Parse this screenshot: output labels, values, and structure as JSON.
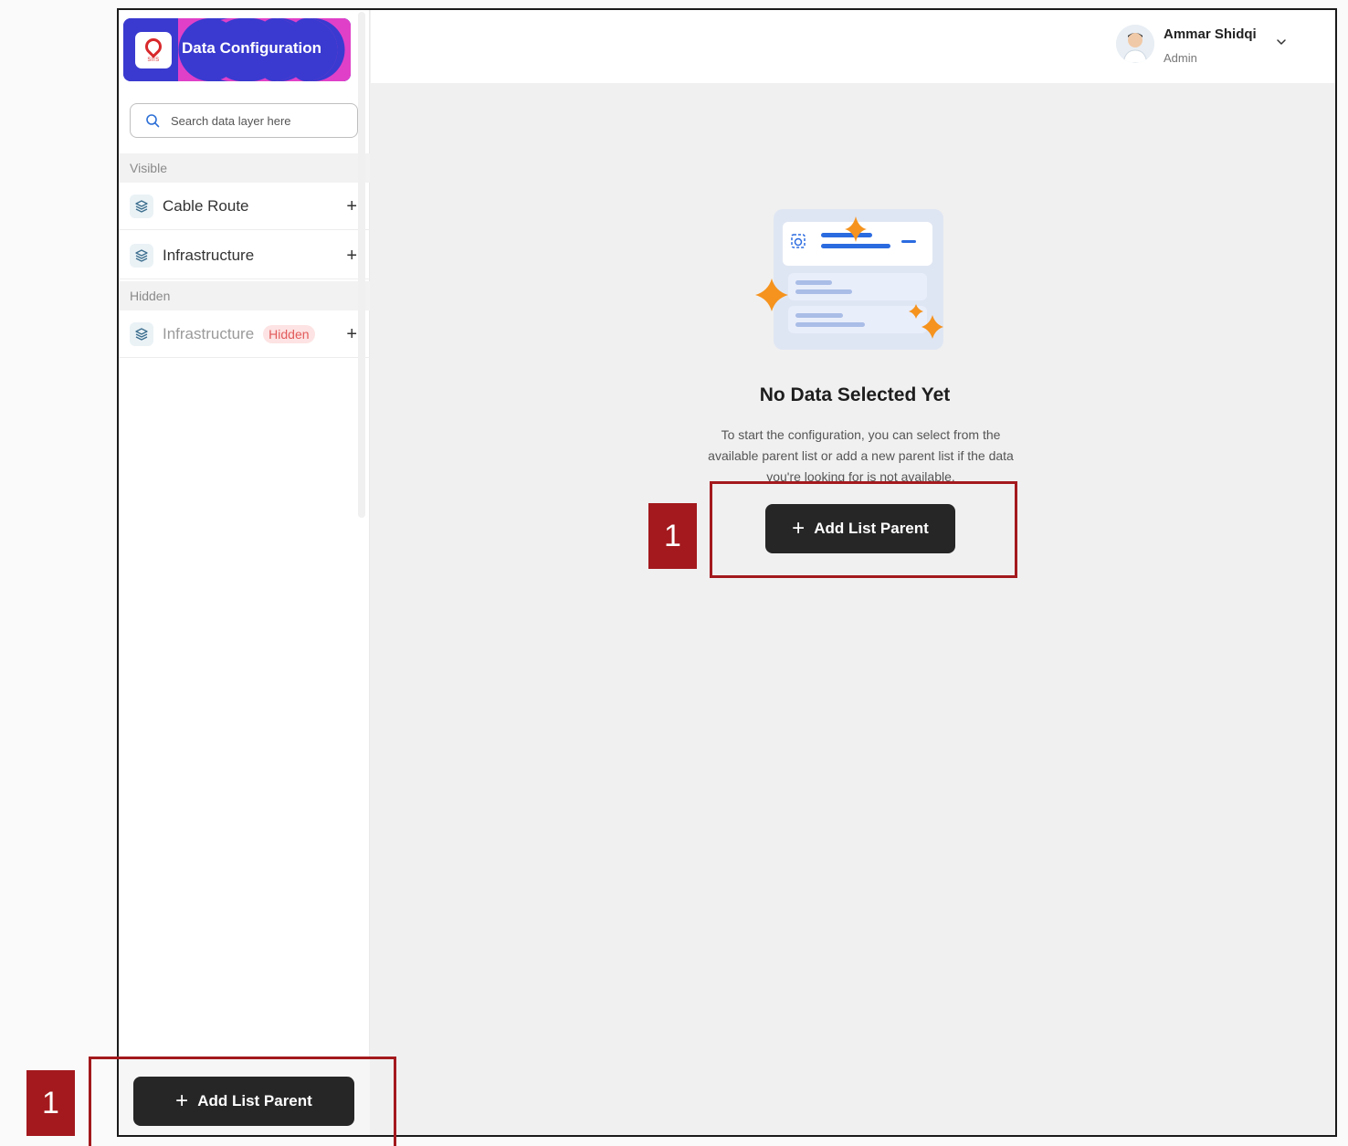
{
  "sidebar": {
    "brand_title": "Data Configuration",
    "brand_logo_text": "SIIS",
    "search_placeholder": "Search data layer here",
    "sections": {
      "visible_label": "Visible",
      "hidden_label": "Hidden"
    },
    "visible_items": [
      {
        "label": "Cable Route"
      },
      {
        "label": "Infrastructure"
      }
    ],
    "hidden_items": [
      {
        "label": "Infrastructure",
        "badge": "Hidden"
      }
    ],
    "footer_button_label": "Add List Parent"
  },
  "header": {
    "user_name": "Ammar Shidqi",
    "user_role": "Admin"
  },
  "empty_state": {
    "title": "No Data Selected Yet",
    "description": "To start the configuration, you can select from the available parent list or add a new parent list if the data you're looking for is not available.",
    "button_label": "Add List Parent"
  },
  "annotations": [
    {
      "label": "1"
    },
    {
      "label": "1"
    }
  ],
  "colors": {
    "brand_blue": "#3a3ad0",
    "brand_pink": "#e040c8",
    "dark_button": "#262626",
    "annotation_red": "#a3191d",
    "hidden_badge_bg": "#fde3e3",
    "hidden_badge_text": "#e25b5b"
  }
}
